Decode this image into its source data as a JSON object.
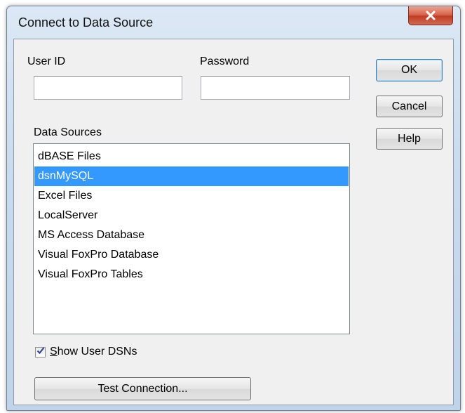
{
  "window": {
    "title": "Connect to Data Source"
  },
  "fields": {
    "user_id_label": "User ID",
    "user_id_value": "",
    "password_label": "Password",
    "password_value": ""
  },
  "buttons": {
    "ok": "OK",
    "cancel": "Cancel",
    "help": "Help",
    "test_connection": "Test Connection..."
  },
  "data_sources": {
    "label": "Data Sources",
    "items": [
      "dBASE Files",
      "dsnMySQL",
      "Excel Files",
      "LocalServer",
      "MS Access Database",
      "Visual FoxPro Database",
      "Visual FoxPro Tables"
    ],
    "selected": "dsnMySQL"
  },
  "show_user_dsns": {
    "label_accel": "S",
    "label_rest": "how User DSNs",
    "checked": true
  },
  "colors": {
    "selection": "#3399ff",
    "close_button": "#c94a33"
  },
  "icons": {
    "close": "close-x-icon",
    "check": "checkmark-icon"
  }
}
